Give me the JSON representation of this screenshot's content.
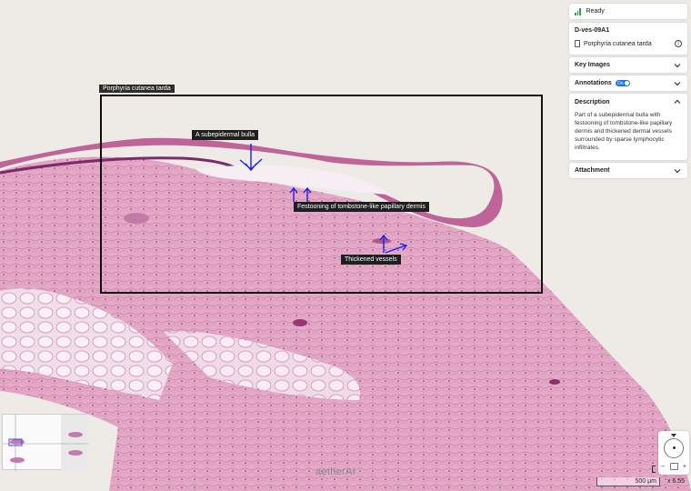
{
  "annotation_region": {
    "label": "Porphyria cutanea tarda"
  },
  "annotation_tags": {
    "bulla": "A subepidermal bulla",
    "festooning": "Festooning of tombstone-like papillary dermis",
    "vessels": "Thickened vessels"
  },
  "status": {
    "text": "Ready",
    "icon": "signal-bars-icon"
  },
  "slide": {
    "id": "D-ves-09A1",
    "diagnosis": "Porphyria cutanea tarda",
    "icons": [
      "clipboard-icon",
      "info-icon"
    ]
  },
  "sections": {
    "key_images": "Key Images",
    "annotations": "Annotations",
    "annotations_toggle": "On",
    "description": "Description",
    "description_text": "Part of a subepidermal bulla with festooning of tombstone-like papillary dermis and thickened dermal vessels surrounded by sparse lymphocytic infiltrates.",
    "attachment": "Attachment"
  },
  "scale": {
    "bar_label": "500 μm",
    "zoom": "x 6.55"
  },
  "watermark": "aetherAI",
  "colors": {
    "accent": "#1a73e8",
    "status_green": "#2e9d4c",
    "annotation_arrow": "#1d1df0"
  }
}
